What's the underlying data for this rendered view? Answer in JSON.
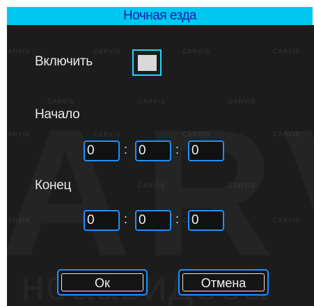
{
  "dialog": {
    "title": "Ночная езда",
    "enable_label": "Включить",
    "enable_checked": false,
    "start_label": "Начало",
    "end_label": "Конец",
    "time_separator": ":",
    "start_time": {
      "hours": "0",
      "minutes": "0",
      "seconds": "0"
    },
    "end_time": {
      "hours": "0",
      "minutes": "0",
      "seconds": "0"
    },
    "ok_label": "Ок",
    "cancel_label": "Отмена"
  },
  "watermark": {
    "logo_text": "CARVIS",
    "big_text": "ARVI",
    "sub_text": "ноаавидеоа"
  },
  "colors": {
    "title_bar": "#00c8f0",
    "title_text": "#1a1aa8",
    "panel": "#1c1c1c",
    "field_border": "#1e90ff",
    "checkbox_border": "#22d4ff"
  }
}
